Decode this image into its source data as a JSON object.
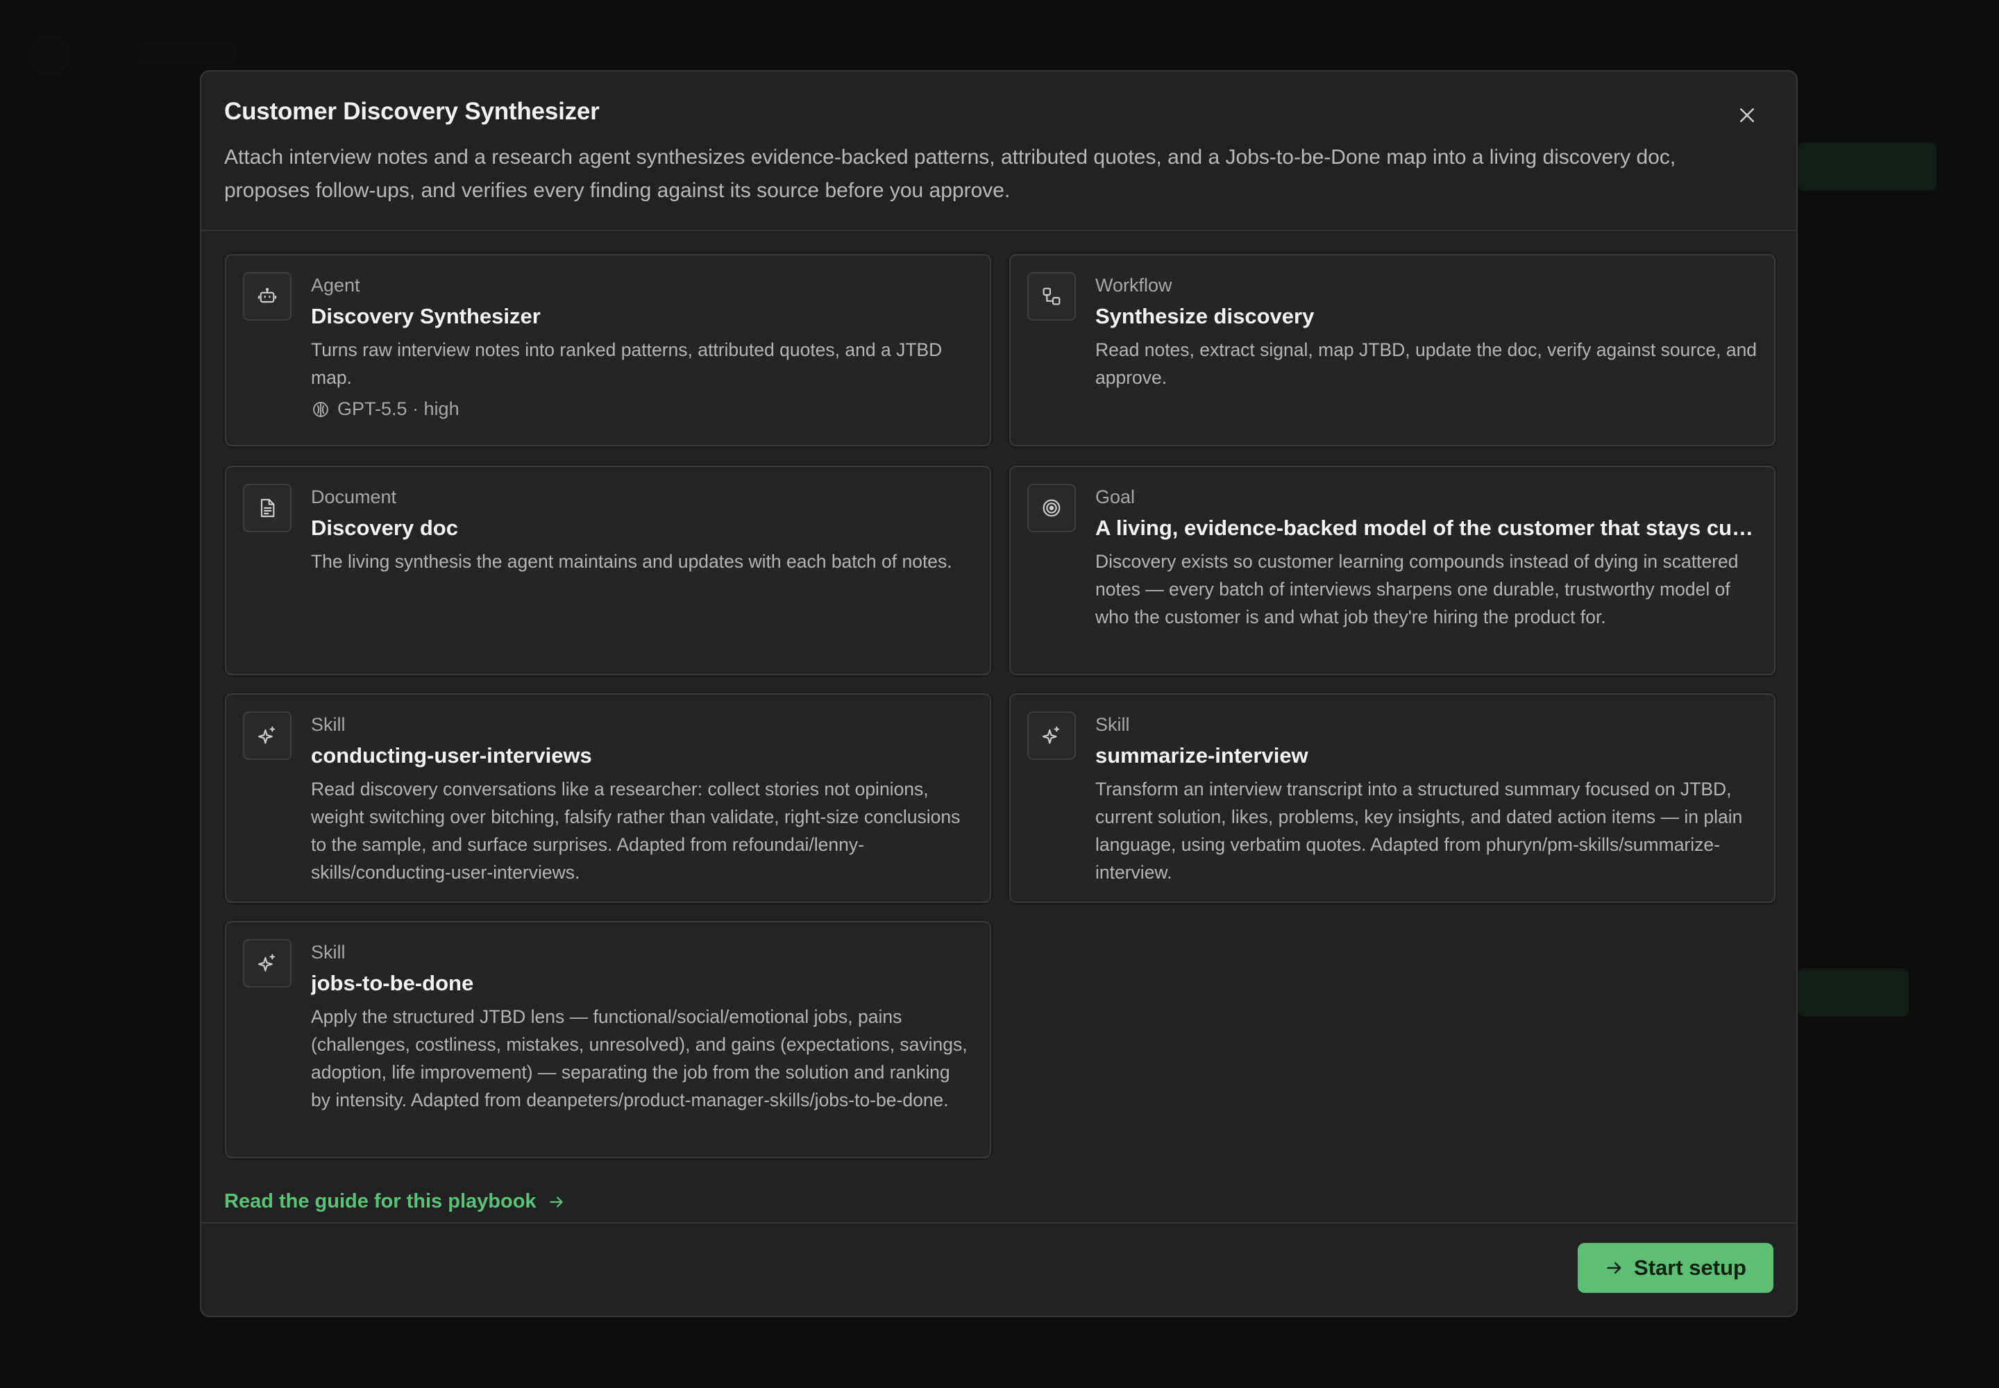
{
  "modal": {
    "title": "Customer Discovery Synthesizer",
    "description": "Attach interview notes and a research agent synthesizes evidence-backed patterns, attributed quotes, and a Jobs-to-be-Done map into a living discovery doc, proposes follow-ups, and verifies every finding against its source before you approve."
  },
  "cards": {
    "agent": {
      "kind": "Agent",
      "name": "Discovery Synthesizer",
      "body": "Turns raw interview notes into ranked patterns, attributed quotes, and a JTBD map.",
      "model": "GPT-5.5 · high",
      "icon": "robot-icon"
    },
    "workflow": {
      "kind": "Workflow",
      "name": "Synthesize discovery",
      "body": "Read notes, extract signal, map JTBD, update the doc, verify against source, and approve.",
      "icon": "workflow-icon"
    },
    "document": {
      "kind": "Document",
      "name": "Discovery doc",
      "body": "The living synthesis the agent maintains and updates with each batch of notes.",
      "icon": "document-icon"
    },
    "goal": {
      "kind": "Goal",
      "name": "A living, evidence-backed model of the customer that stays curr...",
      "body": "Discovery exists so customer learning compounds instead of dying in scattered notes — every batch of interviews sharpens one durable, trustworthy model of who the customer is and what job they're hiring the product for.",
      "icon": "target-icon"
    },
    "skill1": {
      "kind": "Skill",
      "name": "conducting-user-interviews",
      "body": "Read discovery conversations like a researcher: collect stories not opinions, weight switching over bitching, falsify rather than validate, right-size conclusions to the sample, and surface surprises. Adapted from refoundai/lenny-skills/conducting-user-interviews.",
      "icon": "sparkle-icon"
    },
    "skill2": {
      "kind": "Skill",
      "name": "summarize-interview",
      "body": "Transform an interview transcript into a structured summary focused on JTBD, current solution, likes, problems, key insights, and dated action items — in plain language, using verbatim quotes. Adapted from phuryn/pm-skills/summarize-interview.",
      "icon": "sparkle-icon"
    },
    "skill3": {
      "kind": "Skill",
      "name": "jobs-to-be-done",
      "body": "Apply the structured JTBD lens — functional/social/emotional jobs, pains (challenges, costliness, mistakes, unresolved), and gains (expectations, savings, adoption, life improvement) — separating the job from the solution and ranking by intensity. Adapted from deanpeters/product-manager-skills/jobs-to-be-done.",
      "icon": "sparkle-icon"
    }
  },
  "footer": {
    "guide_link": "Read the guide for this playbook",
    "start_button": "Start setup"
  },
  "colors": {
    "accent": "#5cbf74",
    "modal_bg": "#222222",
    "card_bg": "#252525"
  }
}
